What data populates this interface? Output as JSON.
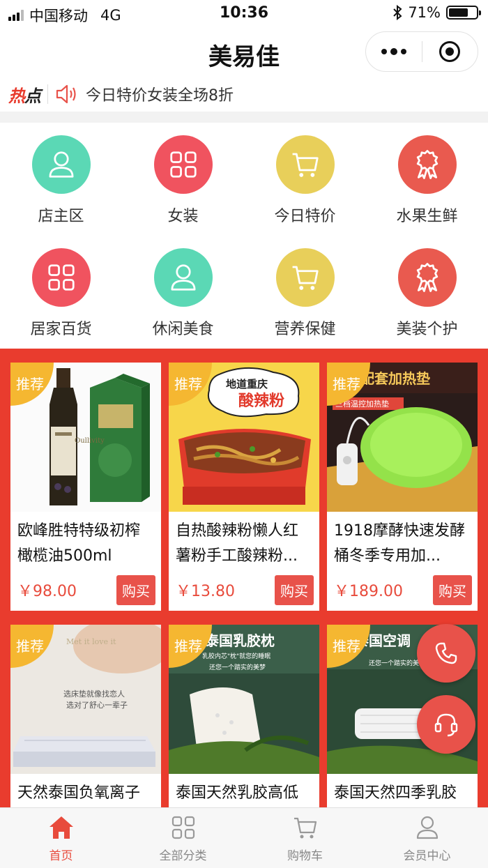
{
  "status_bar": {
    "carrier": "中国移动",
    "network": "4G",
    "time": "10:36",
    "battery": "71%",
    "battery_level": 0.71
  },
  "nav": {
    "title": "美易佳"
  },
  "hot": {
    "tag_red": "热",
    "tag_black": "点",
    "text": "今日特价女装全场8折"
  },
  "categories": [
    {
      "label": "店主区",
      "color": "#5bd8b5",
      "icon": "user-icon"
    },
    {
      "label": "女装",
      "color": "#f0535f",
      "icon": "grid-icon"
    },
    {
      "label": "今日特价",
      "color": "#e8cf5a",
      "icon": "cart-icon"
    },
    {
      "label": "水果生鲜",
      "color": "#e95a4f",
      "icon": "award-icon"
    },
    {
      "label": "居家百货",
      "color": "#f0535f",
      "icon": "grid-icon"
    },
    {
      "label": "休闲美食",
      "color": "#5bd8b5",
      "icon": "user-icon"
    },
    {
      "label": "营养保健",
      "color": "#e8cf5a",
      "icon": "cart-icon"
    },
    {
      "label": "美装个护",
      "color": "#e95a4f",
      "icon": "award-icon"
    }
  ],
  "badge_text": "推荐",
  "buy_label": "购买",
  "products": [
    {
      "title": "欧峰胜特特级初榨橄榄油500ml",
      "price": "￥98.00",
      "image": "olive-oil-image"
    },
    {
      "title": "自热酸辣粉懒人红薯粉手工酸辣粉...",
      "price": "￥13.80",
      "image": "noodles-image",
      "image_text": [
        "地道重庆",
        "酸辣粉"
      ]
    },
    {
      "title": "1918摩酵快速发酵桶冬季专用加...",
      "price": "￥189.00",
      "image": "heating-pad-image",
      "image_text": [
        "桶配套加热垫",
        "三档温控加热垫"
      ]
    },
    {
      "title": "天然泰国负氧离子",
      "image": "mattress-image",
      "image_text": [
        "Met it love it",
        "选床垫就像找恋人",
        "选对了舒心一辈子"
      ]
    },
    {
      "title": "泰国天然乳胶高低",
      "image": "latex-pillow-image",
      "image_text": [
        "泰国乳胶枕",
        "乳胶内芯\"枕\"就您的睡眠",
        "还您一个踏实的美梦"
      ]
    },
    {
      "title": "泰国天然四季乳胶",
      "image": "latex-quilt-image",
      "image_text": [
        "泰国空调",
        "还您一个踏实的美梦"
      ]
    }
  ],
  "float_buttons": [
    "phone-icon",
    "headset-icon"
  ],
  "tabs": [
    {
      "label": "首页",
      "icon": "home-icon",
      "active": true
    },
    {
      "label": "全部分类",
      "icon": "grid-icon",
      "active": false
    },
    {
      "label": "购物车",
      "icon": "cart-icon",
      "active": false
    },
    {
      "label": "会员中心",
      "icon": "user-icon",
      "active": false
    }
  ],
  "colors": {
    "accent": "#e84b3c",
    "promo_bg": "#e93c2e",
    "badge": "#f5b731"
  }
}
